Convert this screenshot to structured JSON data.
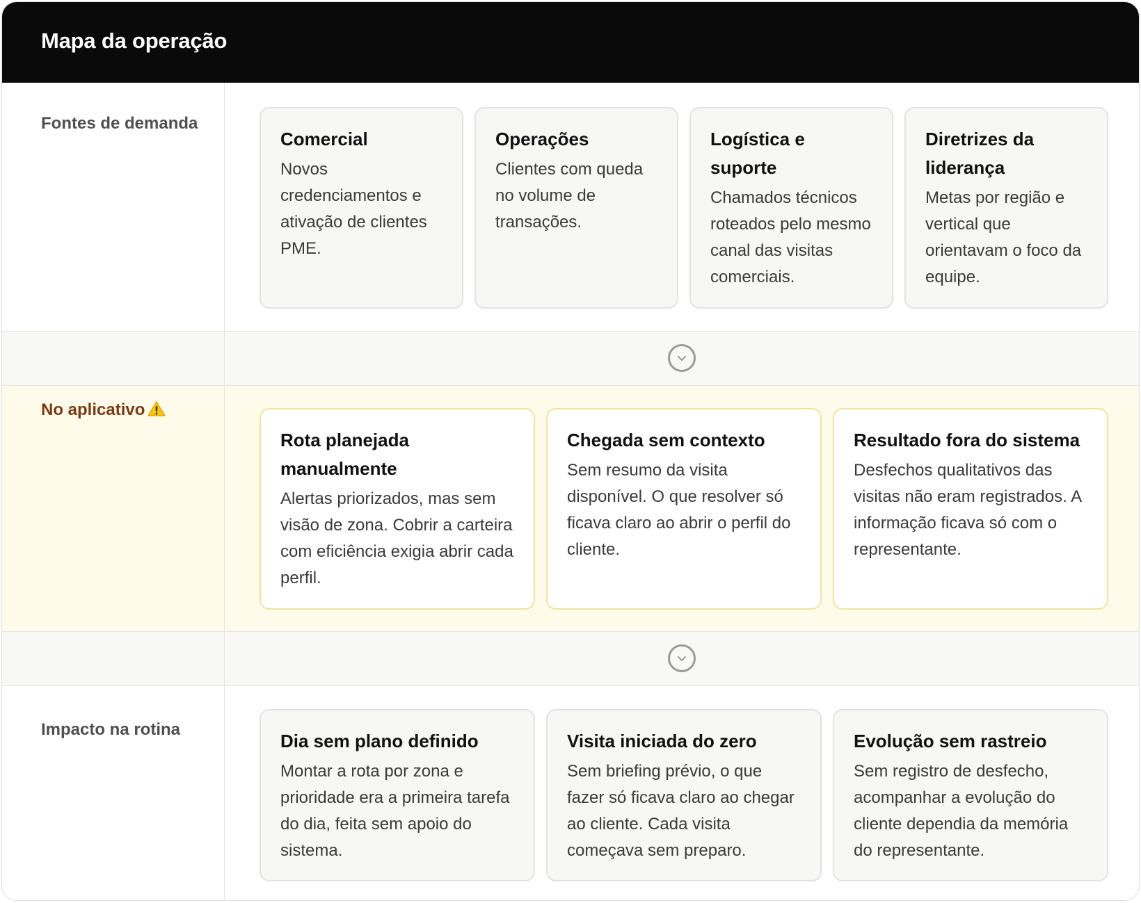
{
  "header": {
    "title": "Mapa da operação"
  },
  "rows": {
    "sources": {
      "label": "Fontes de demanda",
      "cards": [
        {
          "title": "Comercial",
          "body": "Novos credenciamentos e ativação de clientes PME."
        },
        {
          "title": "Operações",
          "body": "Clientes com queda no volume de transações."
        },
        {
          "title": "Logística e suporte",
          "body": "Chamados técnicos roteados pelo mesmo canal das visitas comerciais."
        },
        {
          "title": "Diretrizes da liderança",
          "body": "Metas por região e vertical que orientavam o foco da equipe."
        }
      ]
    },
    "app": {
      "label": "No aplicativo",
      "warning_icon": "warning-icon",
      "cards": [
        {
          "title": "Rota planejada manualmente",
          "body": "Alertas priorizados, mas sem visão de zona. Cobrir a carteira com eficiência exigia abrir cada perfil."
        },
        {
          "title": "Chegada sem contexto",
          "body": "Sem resumo da visita disponível. O que resolver só ficava claro ao abrir o perfil do cliente."
        },
        {
          "title": "Resultado fora do sistema",
          "body": "Desfechos qualitativos das visitas não eram registrados. A informação ficava só com o representante."
        }
      ]
    },
    "impact": {
      "label": "Impacto na rotina",
      "cards": [
        {
          "title": "Dia sem plano definido",
          "body": "Montar a rota por zona e prioridade era a primeira tarefa do dia, feita sem apoio do sistema."
        },
        {
          "title": "Visita iniciada do zero",
          "body": "Sem briefing prévio, o que fazer só ficava claro ao chegar ao cliente. Cada visita começava sem preparo."
        },
        {
          "title": "Evolução sem rastreio",
          "body": "Sem registro de desfecho, acompanhar a evolução do cliente dependia da memória do representante."
        }
      ]
    }
  },
  "connectors": {
    "icon": "chevron-down-icon"
  },
  "colors": {
    "header_bg": "#0a0a0a",
    "warning_band_bg": "#fefbea",
    "warning_label": "#7a3b12",
    "warning_card_border": "#f1e3a0",
    "connector_bg": "#f8f8f7"
  }
}
